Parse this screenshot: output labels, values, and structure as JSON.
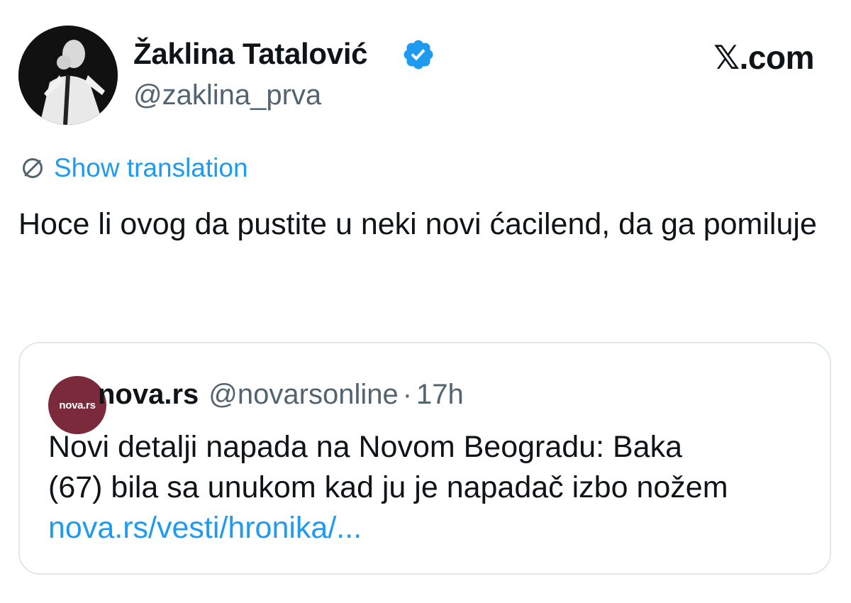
{
  "author": {
    "display_name": "Žaklina Tatalović",
    "handle": "@zaklina_prva",
    "verified_icon": "verified-badge-icon",
    "accent": "#1d9bf0"
  },
  "brand": {
    "label": "𝕏.com"
  },
  "translation": {
    "icon": "translate-globe-icon",
    "label": "Show translation"
  },
  "tweet": {
    "text": "Hoce li ovog da pustite u neki novi ćacilend, da ga pomiluje"
  },
  "quote": {
    "avatar_text": "nova.rs",
    "name": "nova.rs",
    "handle": "@novarsonline",
    "separator": "·",
    "time": "17h",
    "text_line1": "Novi detalji napada na Novom Beogradu: Baka",
    "text_line2": "(67) bila sa unukom kad ju je napadač izbo nožem",
    "link": "nova.rs/vesti/hronika/..."
  }
}
